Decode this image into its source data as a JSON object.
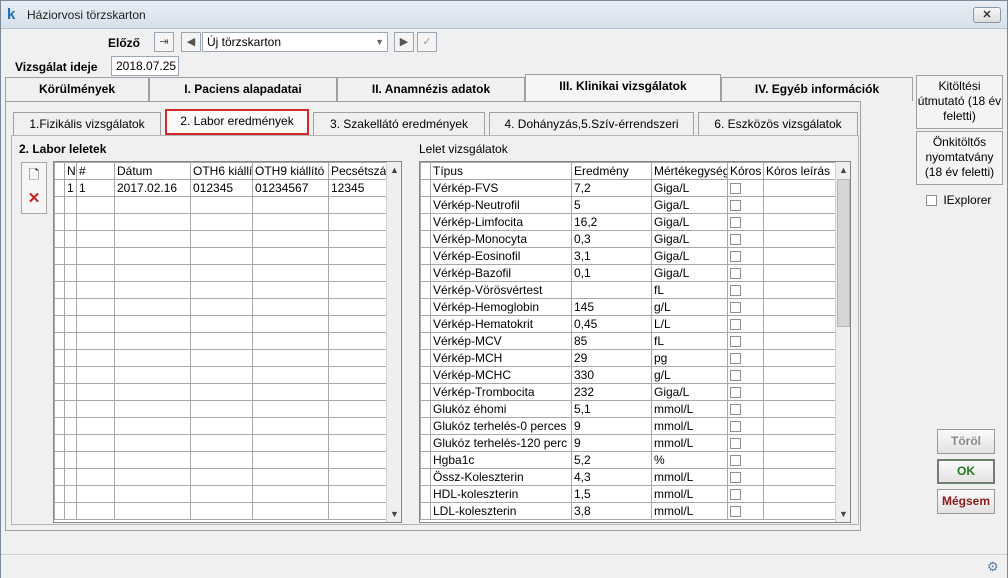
{
  "window": {
    "title": "Háziorvosi törzskarton",
    "close_label": "✕"
  },
  "header": {
    "prev_label": "Előző",
    "record_select": "Új törzskarton",
    "exam_date_label": "Vizsgálat ideje",
    "exam_date": "2018.07.25"
  },
  "tabs": [
    {
      "label": "Körülmények"
    },
    {
      "label": "I. Paciens alapadatai"
    },
    {
      "label": "II. Anamnézis adatok"
    },
    {
      "label": "III. Klinikai vizsgálatok"
    },
    {
      "label": "IV. Egyéb információk"
    }
  ],
  "subtabs": [
    {
      "label": "1.Fizikális vizsgálatok"
    },
    {
      "label": "2. Labor eredmények"
    },
    {
      "label": "3. Szakellátó eredmények"
    },
    {
      "label": "4. Dohányzás,5.Szív-érrendszeri"
    },
    {
      "label": "6. Eszközös vizsgálatok"
    }
  ],
  "side": {
    "guide_label": "Kitöltési útmutató (18 év feletti)",
    "selfprint_label": "Önkitöltős nyomtatvány (18 év feletti)",
    "iexplorer_label": "IExplorer"
  },
  "labor": {
    "title": "2. Labor leletek",
    "columns": [
      "N",
      "#",
      "Dátum",
      "OTH6 kiállí",
      "OTH9 kiállító",
      "Pecsétszám"
    ],
    "rows": [
      [
        "1",
        "1",
        "2017.02.16",
        "012345",
        "01234567",
        "12345"
      ]
    ]
  },
  "lelet": {
    "title": "Lelet vizsgálatok",
    "columns": [
      "Típus",
      "Eredmény",
      "Mértékegység",
      "Kóros",
      "Kóros leírás"
    ],
    "rows": [
      [
        "Vérkép-FVS",
        "7,2",
        "Giga/L"
      ],
      [
        "Vérkép-Neutrofil",
        "5",
        "Giga/L"
      ],
      [
        "Vérkép-Limfocita",
        "16,2",
        "Giga/L"
      ],
      [
        "Vérkép-Monocyta",
        "0,3",
        "Giga/L"
      ],
      [
        "Vérkép-Eosinofil",
        "3,1",
        "Giga/L"
      ],
      [
        "Vérkép-Bazofil",
        "0,1",
        "Giga/L"
      ],
      [
        "Vérkép-Vörösvértest",
        "",
        "fL"
      ],
      [
        "Vérkép-Hemoglobin",
        "145",
        "g/L"
      ],
      [
        "Vérkép-Hematokrit",
        "0,45",
        "L/L"
      ],
      [
        "Vérkép-MCV",
        "85",
        "fL"
      ],
      [
        "Vérkép-MCH",
        "29",
        "pg"
      ],
      [
        "Vérkép-MCHC",
        "330",
        "g/L"
      ],
      [
        "Vérkép-Trombocita",
        "232",
        "Giga/L"
      ],
      [
        "Glukóz éhomi",
        "5,1",
        "mmol/L"
      ],
      [
        "Glukóz terhelés-0 perces",
        "9",
        "mmol/L"
      ],
      [
        "Glukóz terhelés-120 perc",
        "9",
        "mmol/L"
      ],
      [
        "Hgba1c",
        "5,2",
        "%"
      ],
      [
        "Össz-Koleszterin",
        "4,3",
        "mmol/L"
      ],
      [
        "HDL-koleszterin",
        "1,5",
        "mmol/L"
      ],
      [
        "LDL-koleszterin",
        "3,8",
        "mmol/L"
      ]
    ]
  },
  "buttons": {
    "delete": "Töröl",
    "ok": "OK",
    "cancel": "Mégsem"
  },
  "colors": {
    "highlight": "#d12a2a",
    "ok_green": "#1f7a1f",
    "cancel_red": "#8b1a1a"
  }
}
